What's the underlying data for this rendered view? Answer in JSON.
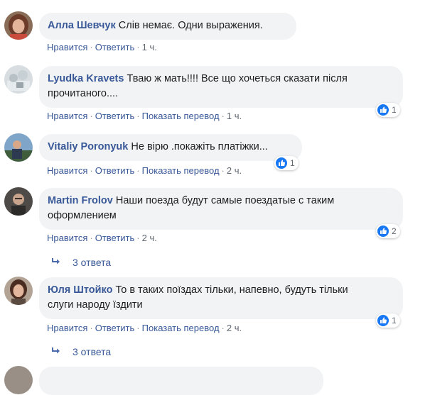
{
  "comments": [
    {
      "author": "Алла Шевчук",
      "text": "Слів немає. Одни выражения.",
      "actions": [
        "Нравится",
        "Ответить"
      ],
      "time": "1 ч.",
      "reactions": null,
      "replies": null
    },
    {
      "author": "Lyudka Kravets",
      "text_line1": "Тваю ж мать!!!! Все що хочеться сказати після",
      "text_line2": "прочитаного....",
      "actions": [
        "Нравится",
        "Ответить",
        "Показать перевод"
      ],
      "time": "1 ч.",
      "reactions": "1"
    },
    {
      "author": "Vitaliy Poronyuk",
      "text": "Не вірю .покажіть платіжки...",
      "actions": [
        "Нравится",
        "Ответить",
        "Показать перевод"
      ],
      "time": "2 ч.",
      "reactions": "1"
    },
    {
      "author": "Martin Frolov",
      "text_line1": "Наши поезда будут самые поездатые с таким",
      "text_line2": "оформлением",
      "actions": [
        "Нравится",
        "Ответить"
      ],
      "time": "2 ч.",
      "reactions": "2",
      "replies": "3 ответа"
    },
    {
      "author": "Юля Штойко",
      "text_line1": "То в таких поїздах тільки, напевно, будуть тільки",
      "text_line2": "слуги народу їздити",
      "actions": [
        "Нравится",
        "Ответить",
        "Показать перевод"
      ],
      "time": "2 ч.",
      "reactions": "1",
      "replies": "3 ответа"
    }
  ],
  "colors": {
    "link": "#385898",
    "bubble": "#f2f3f5",
    "meta": "#606770",
    "like": "#1877f2"
  },
  "icons": [
    "like-icon",
    "reply-arrow-icon",
    "avatar"
  ]
}
